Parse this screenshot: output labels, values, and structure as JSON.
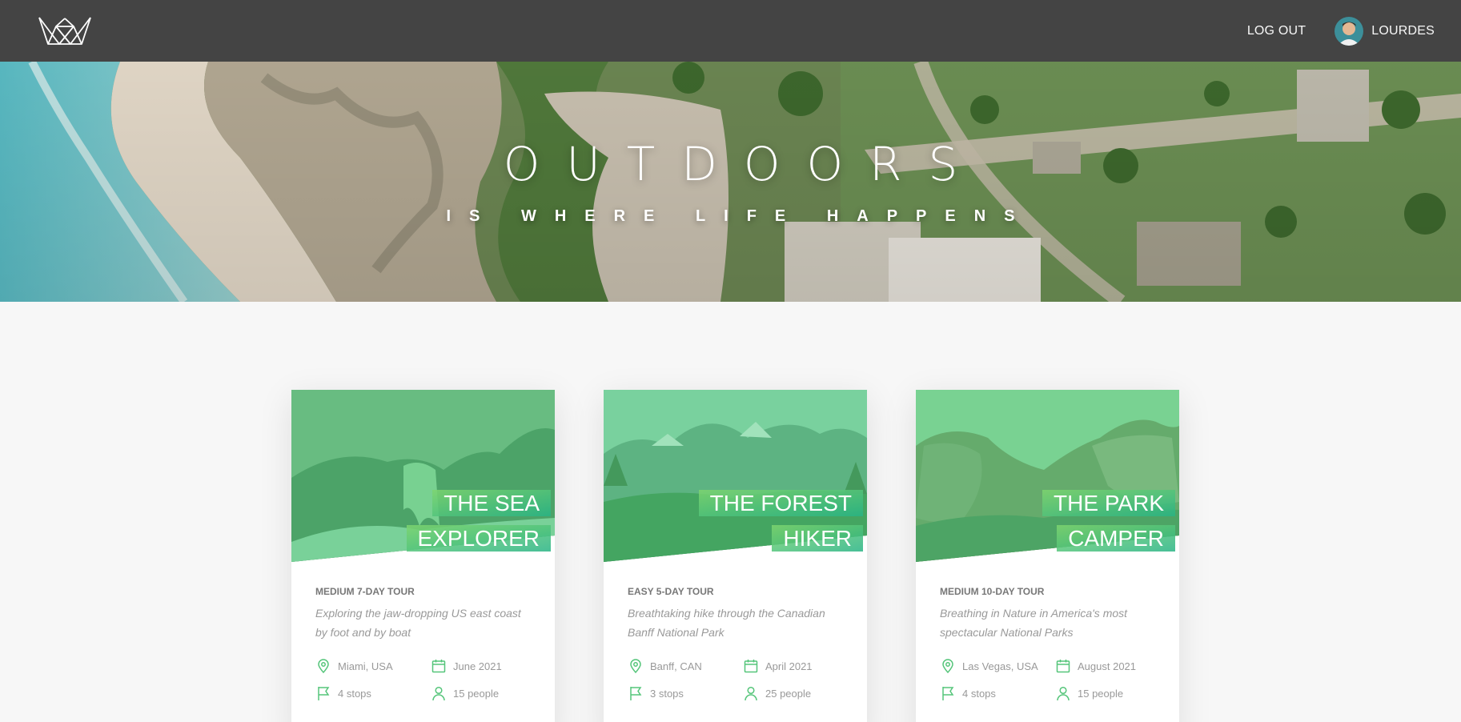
{
  "header": {
    "logout_label": "LOG OUT",
    "user_name": "LOURDES"
  },
  "hero": {
    "title": "OUTDOORS",
    "subtitle": "IS WHERE LIFE HAPPENS"
  },
  "colors": {
    "header_bg": "#444444",
    "primary_green": "#55c57a",
    "gradient_light": "#7ed56f",
    "gradient_dark": "#28b485",
    "page_bg": "#f7f7f7"
  },
  "tours": [
    {
      "title_line_1": "THE SEA",
      "title_line_2": "EXPLORER",
      "sub_heading": "MEDIUM 7-DAY TOUR",
      "summary": "Exploring the jaw-dropping US east coast by foot and by boat",
      "location": "Miami, USA",
      "date": "June 2021",
      "stops": "4 stops",
      "group_size": "15 people"
    },
    {
      "title_line_1": "THE FOREST",
      "title_line_2": "HIKER",
      "sub_heading": "EASY 5-DAY TOUR",
      "summary": "Breathtaking hike through the Canadian Banff National Park",
      "location": "Banff, CAN",
      "date": "April 2021",
      "stops": "3 stops",
      "group_size": "25 people"
    },
    {
      "title_line_1": "THE PARK",
      "title_line_2": "CAMPER",
      "sub_heading": "MEDIUM 10-DAY TOUR",
      "summary": "Breathing in Nature in America's most spectacular National Parks",
      "location": "Las Vegas, USA",
      "date": "August 2021",
      "stops": "4 stops",
      "group_size": "15 people"
    }
  ],
  "icons": {
    "location": "map-pin-icon",
    "date": "calendar-icon",
    "stops": "flag-icon",
    "group_size": "user-icon"
  }
}
